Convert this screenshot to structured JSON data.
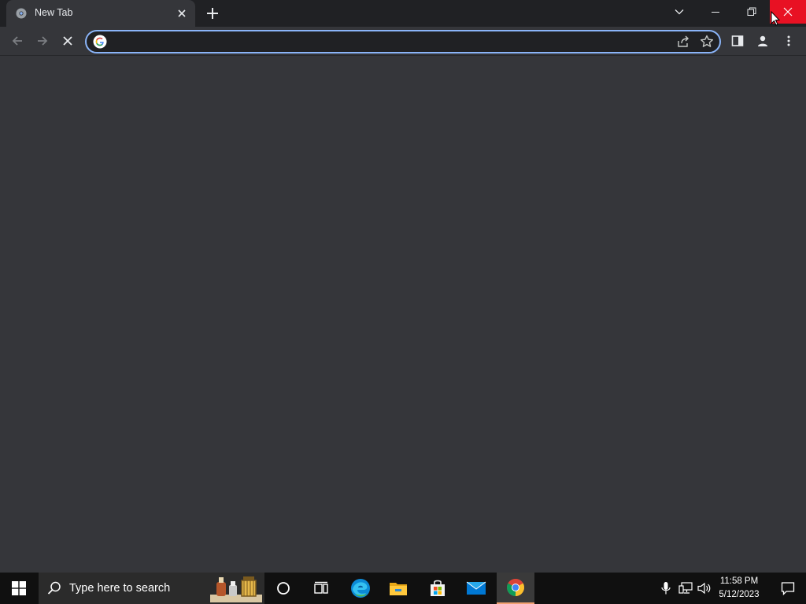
{
  "browser": {
    "tab": {
      "title": "New Tab"
    },
    "omnibox": {
      "value": "",
      "placeholder": ""
    }
  },
  "taskbar": {
    "search_placeholder": "Type here to search",
    "clock": {
      "time": "11:58 PM",
      "date": "5/12/2023"
    },
    "apps": [
      "cortana-icon",
      "task-view-icon",
      "edge-icon",
      "file-explorer-icon",
      "store-icon",
      "mail-icon",
      "chrome-icon"
    ]
  },
  "colors": {
    "tabstrip": "#202124",
    "toolbar": "#35363a",
    "omnibox_focus": "#8ab4f8",
    "close_hover": "#e81123",
    "taskbar": "#101010"
  }
}
